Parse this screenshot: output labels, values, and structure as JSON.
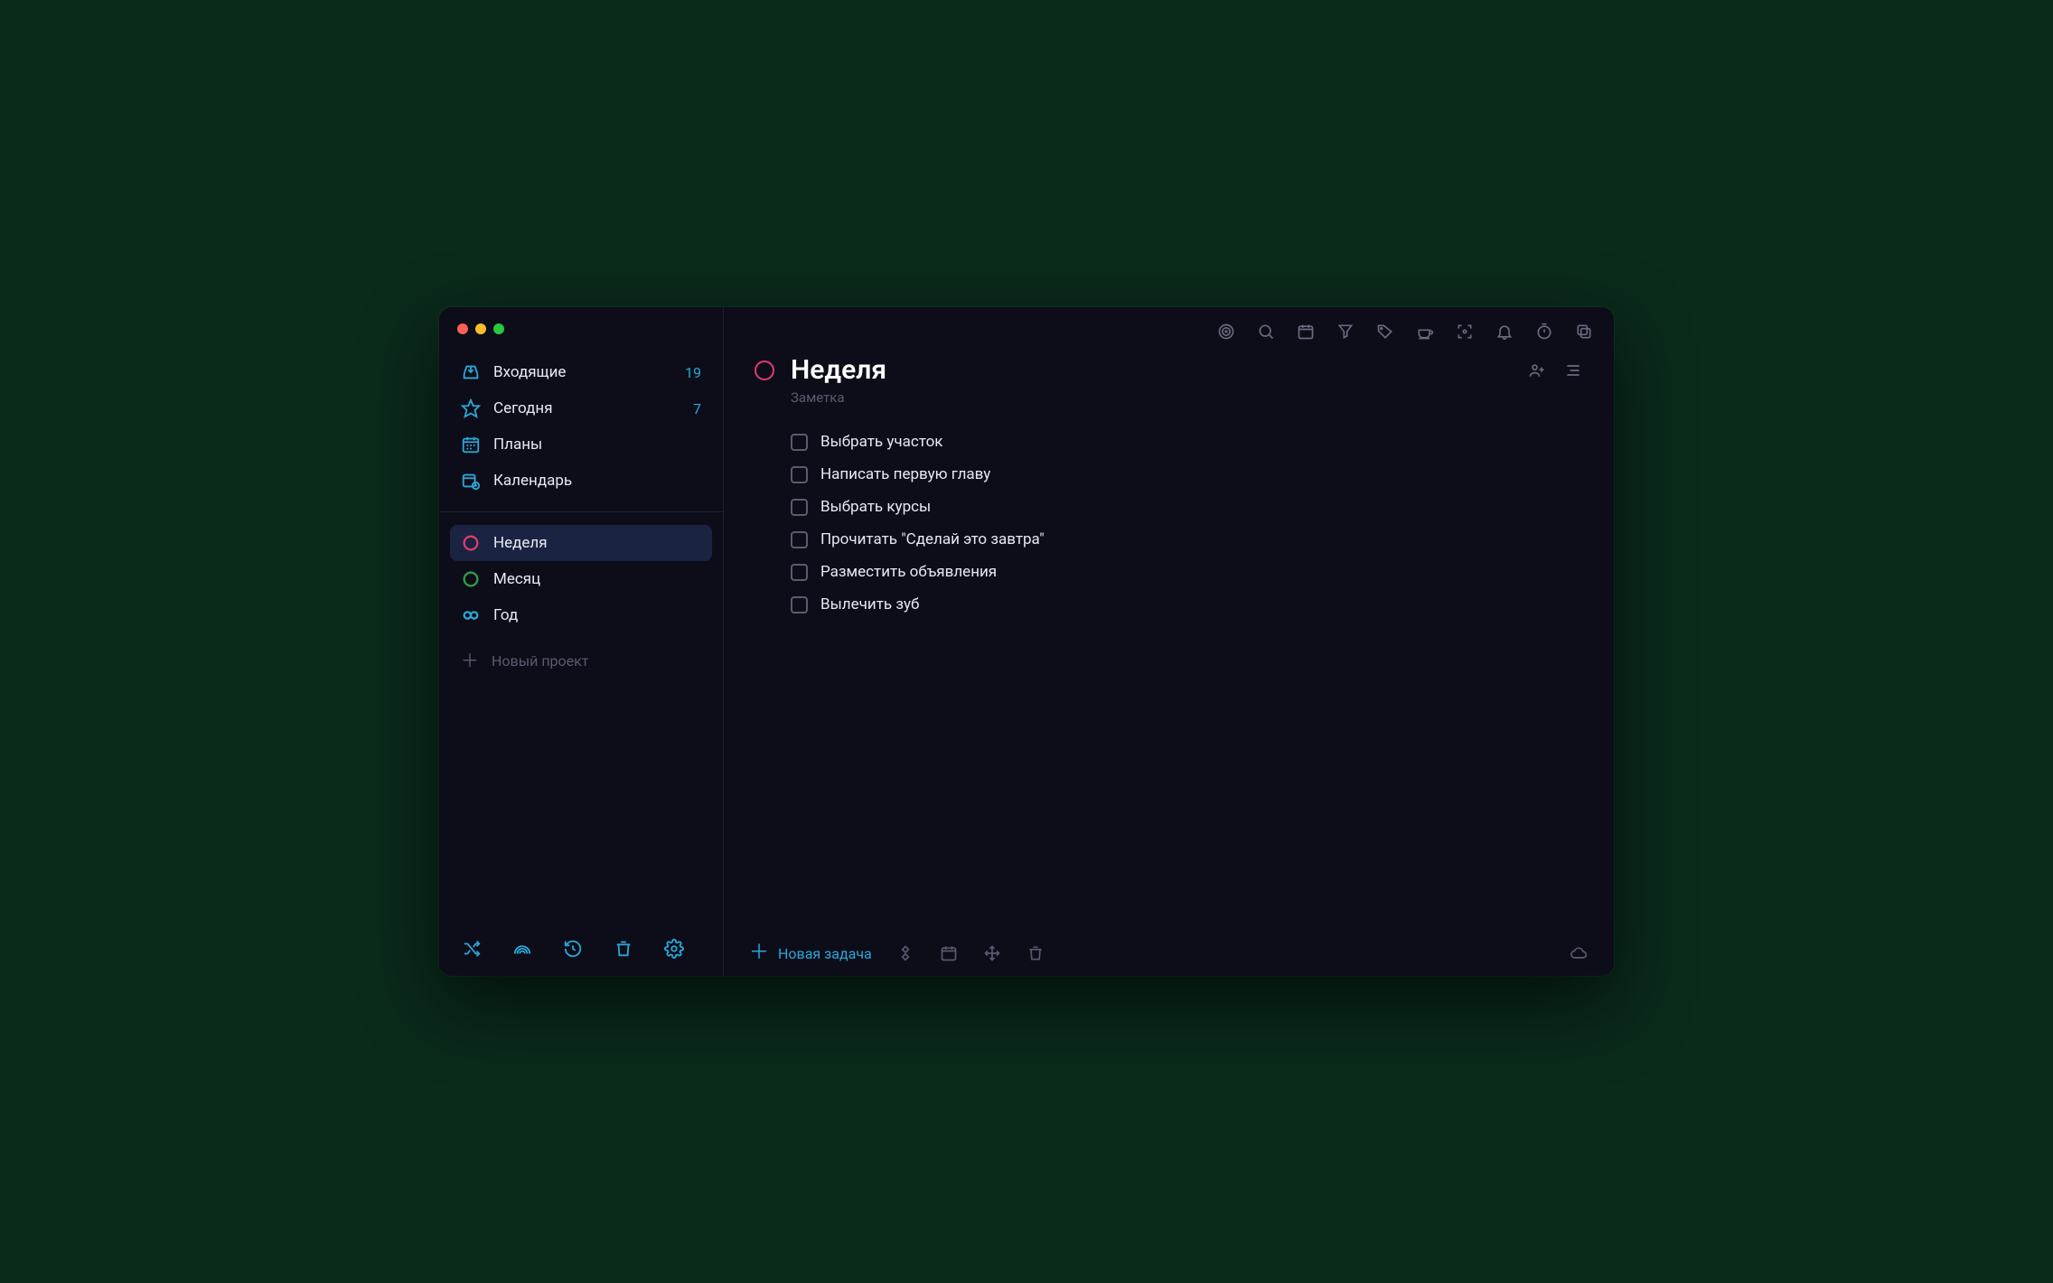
{
  "sidebar": {
    "nav": [
      {
        "id": "inbox",
        "label": "Входящие",
        "count": "19"
      },
      {
        "id": "today",
        "label": "Сегодня",
        "count": "7"
      },
      {
        "id": "plans",
        "label": "Планы",
        "count": ""
      },
      {
        "id": "calendar",
        "label": "Календарь",
        "count": ""
      }
    ],
    "projects": [
      {
        "id": "week",
        "label": "Неделя",
        "color": "#e23a6e",
        "selected": true
      },
      {
        "id": "month",
        "label": "Месяц",
        "color": "#2ea043",
        "selected": false
      },
      {
        "id": "year",
        "label": "Год",
        "color": "#2aa7d6",
        "selected": false
      }
    ],
    "new_project_label": "Новый проект"
  },
  "main": {
    "title": "Неделя",
    "subtitle": "Заметка",
    "tasks": [
      {
        "label": "Выбрать участок"
      },
      {
        "label": "Написать первую главу"
      },
      {
        "label": "Выбрать курсы"
      },
      {
        "label": "Прочитать \"Сделай это завтра\""
      },
      {
        "label": "Разместить объявления"
      },
      {
        "label": "Вылечить зуб"
      }
    ],
    "new_task_label": "Новая задача"
  },
  "colors": {
    "accent": "#2aa7d6",
    "pink": "#e23a6e",
    "green": "#2ea043",
    "bg": "#0d0d1a"
  }
}
